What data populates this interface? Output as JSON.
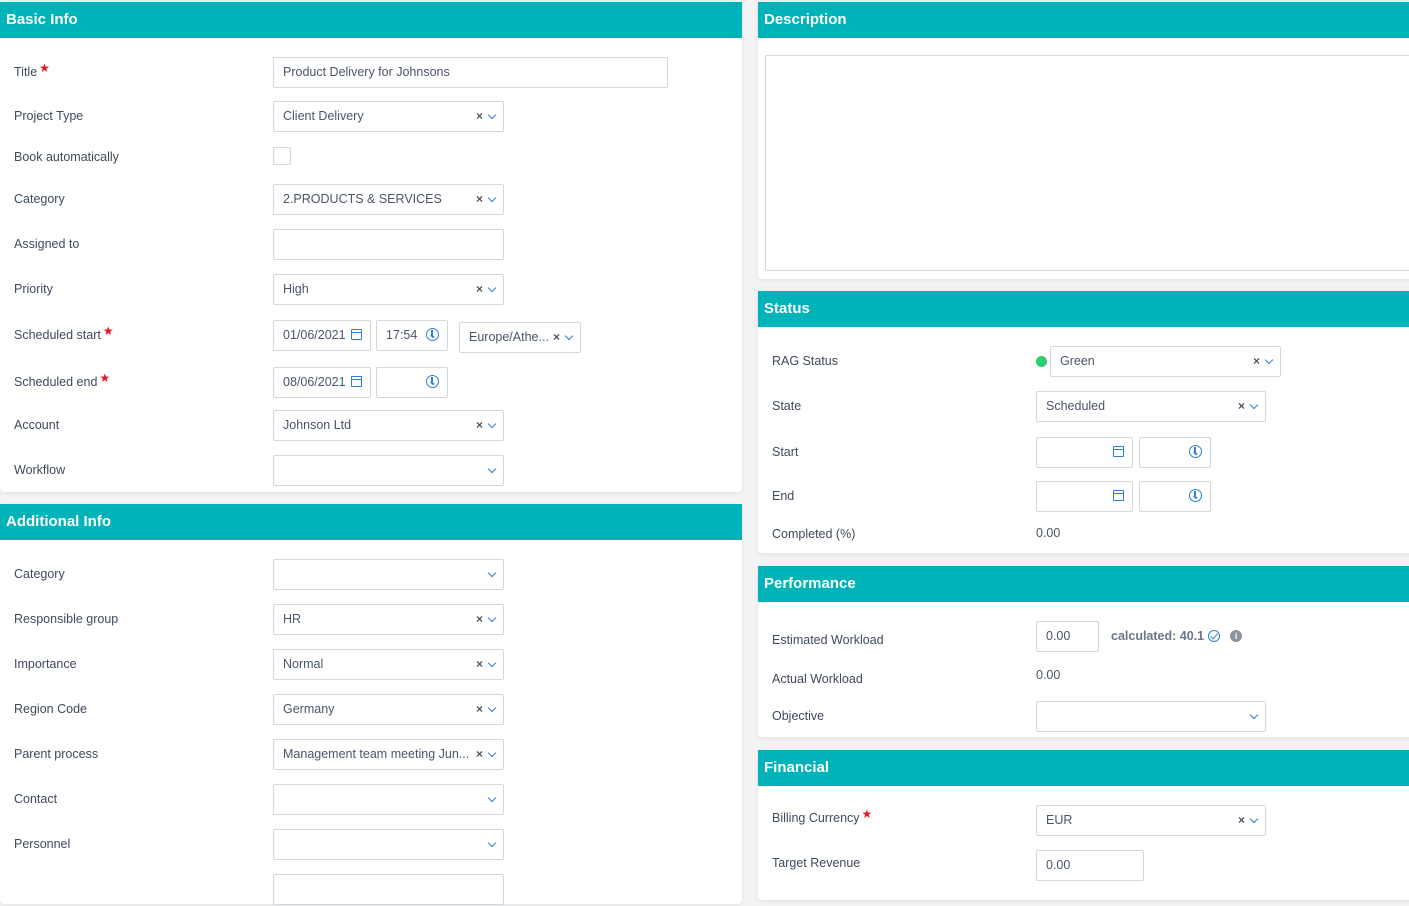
{
  "basic_info": {
    "title": "Basic Info",
    "fields": {
      "title": {
        "label": "Title",
        "value": "Product Delivery for Johnsons"
      },
      "project_type": {
        "label": "Project Type",
        "value": "Client Delivery"
      },
      "book_automatically": {
        "label": "Book automatically",
        "checked": false
      },
      "category": {
        "label": "Category",
        "value": "2.PRODUCTS & SERVICES"
      },
      "assigned_to": {
        "label": "Assigned to",
        "value": ""
      },
      "priority": {
        "label": "Priority",
        "value": "High"
      },
      "scheduled_start": {
        "label": "Scheduled start",
        "date": "01/06/2021",
        "time": "17:54",
        "timezone": "Europe/Athe..."
      },
      "scheduled_end": {
        "label": "Scheduled end",
        "date": "08/06/2021",
        "time": ""
      },
      "account": {
        "label": "Account",
        "value": "Johnson Ltd"
      },
      "workflow": {
        "label": "Workflow",
        "value": ""
      }
    }
  },
  "additional_info": {
    "title": "Additional Info",
    "fields": {
      "category": {
        "label": "Category",
        "value": ""
      },
      "responsible_group": {
        "label": "Responsible group",
        "value": "HR"
      },
      "importance": {
        "label": "Importance",
        "value": "Normal"
      },
      "region_code": {
        "label": "Region Code",
        "value": "Germany"
      },
      "parent_process": {
        "label": "Parent process",
        "value": "Management team meeting Jun..."
      },
      "contact": {
        "label": "Contact",
        "value": ""
      },
      "personnel": {
        "label": "Personnel",
        "value": ""
      }
    }
  },
  "description": {
    "title": "Description",
    "value": ""
  },
  "status": {
    "title": "Status",
    "fields": {
      "rag_status": {
        "label": "RAG Status",
        "value": "Green",
        "color": "#2ecc71"
      },
      "state": {
        "label": "State",
        "value": "Scheduled"
      },
      "start": {
        "label": "Start",
        "date": "",
        "time": ""
      },
      "end": {
        "label": "End",
        "date": "",
        "time": ""
      },
      "completed": {
        "label": "Completed (%)",
        "value": "0.00"
      }
    }
  },
  "performance": {
    "title": "Performance",
    "fields": {
      "estimated_workload": {
        "label": "Estimated Workload",
        "value": "0.00",
        "calculated": "calculated: 40.1"
      },
      "actual_workload": {
        "label": "Actual Workload",
        "value": "0.00"
      },
      "objective": {
        "label": "Objective",
        "value": ""
      }
    }
  },
  "financial": {
    "title": "Financial",
    "fields": {
      "billing_currency": {
        "label": "Billing Currency",
        "value": "EUR"
      },
      "target_revenue": {
        "label": "Target Revenue",
        "value": "0.00"
      }
    }
  },
  "icons": {
    "required": "★",
    "clear": "×",
    "info": "i"
  },
  "colors": {
    "header": "#00b3b8",
    "accent": "#2a7fd4",
    "required": "#e8171f",
    "rag_green": "#2ecc71"
  }
}
